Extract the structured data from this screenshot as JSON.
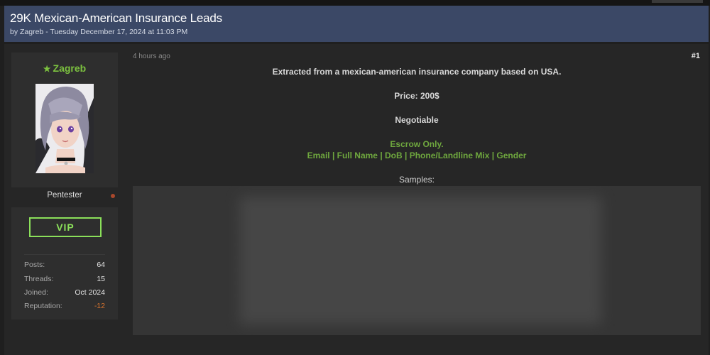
{
  "thread": {
    "title": "29K Mexican-American Insurance Leads",
    "meta": "by Zagreb - Tuesday December 17, 2024 at 11:03 PM"
  },
  "author": {
    "username": "Zagreb",
    "rank": "Pentester",
    "badge": "VIP",
    "stats": [
      {
        "label": "Posts:",
        "value": "64"
      },
      {
        "label": "Threads:",
        "value": "15"
      },
      {
        "label": "Joined:",
        "value": "Oct 2024"
      },
      {
        "label": "Reputation:",
        "value": "-12"
      }
    ]
  },
  "post": {
    "time": "4 hours ago",
    "number": "#1",
    "line1": "Extracted from a mexican-american insurance company based on USA.",
    "price": "Price: 200$",
    "negotiable": "Negotiable",
    "escrow": "Escrow Only.",
    "fields": "Email | Full Name | DoB | Phone/Landline Mix | Gender",
    "samples_label": "Samples:"
  },
  "colors": {
    "header_bg": "#3b4866",
    "username": "#7cc13f",
    "vip": "#8be05a",
    "green_text": "#6fa83e",
    "negative": "#d9742e"
  },
  "icons": {
    "username_star": "star-icon",
    "status": "status-dot-icon"
  }
}
